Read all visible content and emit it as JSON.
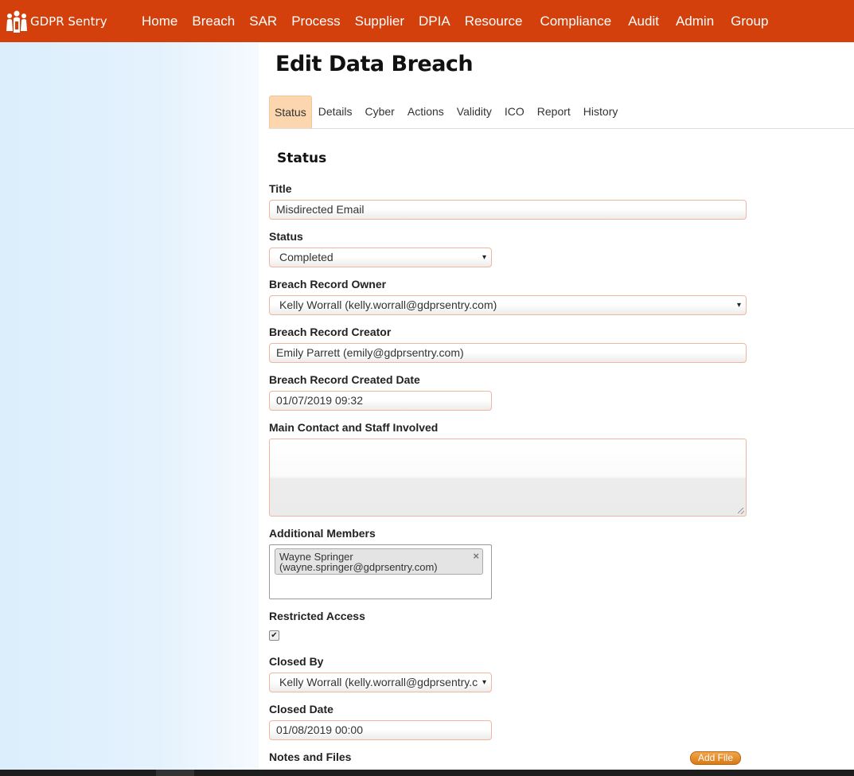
{
  "app": {
    "brand": "GDPR Sentry",
    "accent_color": "#d4400c"
  },
  "nav": {
    "items": [
      "Home",
      "Breach",
      "SAR",
      "Process",
      "Supplier",
      "DPIA",
      "Resource",
      "Compliance",
      "Audit",
      "Admin",
      "Group"
    ]
  },
  "page": {
    "title": "Edit Data Breach"
  },
  "tabs": {
    "items": [
      "Status",
      "Details",
      "Cyber",
      "Actions",
      "Validity",
      "ICO",
      "Report",
      "History"
    ],
    "active": "Status"
  },
  "form": {
    "section_title": "Status",
    "title_label": "Title",
    "title_value": "Misdirected Email",
    "status_label": "Status",
    "status_value": "Completed",
    "owner_label": "Breach Record Owner",
    "owner_value": "Kelly Worrall (kelly.worrall@gdprsentry.com)",
    "creator_label": "Breach Record Creator",
    "creator_value": "Emily Parrett (emily@gdprsentry.com)",
    "created_date_label": "Breach Record Created Date",
    "created_date_value": "01/07/2019 09:32",
    "contact_label": "Main Contact and Staff Involved",
    "contact_value": "",
    "members_label": "Additional Members",
    "member_line1": "Wayne Springer",
    "member_line2": "(wayne.springer@gdprsentry.com)",
    "member_remove": "×",
    "restricted_label": "Restricted Access",
    "restricted_checked": true,
    "restricted_mark": "✔",
    "closed_by_label": "Closed By",
    "closed_by_value": "Kelly Worrall (kelly.worrall@gdprsentry.c",
    "closed_date_label": "Closed Date",
    "closed_date_value": "01/08/2019 00:00",
    "notes_label": "Notes and Files",
    "add_file_label": "Add File",
    "caret": "▾"
  }
}
